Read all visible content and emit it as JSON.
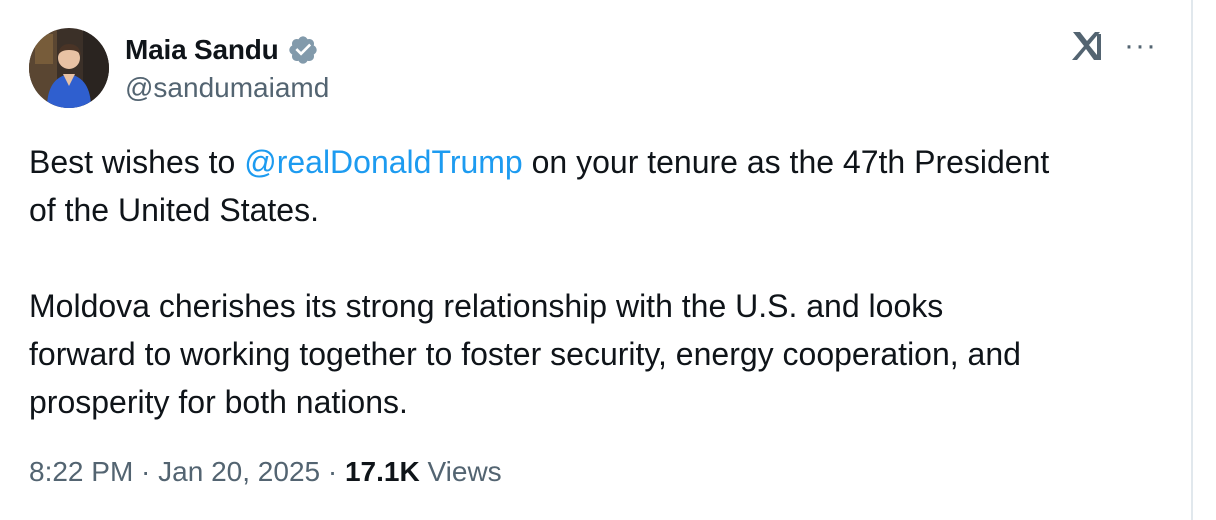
{
  "author": {
    "display_name": "Maia Sandu",
    "handle": "@sandumaiamd",
    "verified": true,
    "verified_badge_color": "#829aab"
  },
  "icons": {
    "x_logo": "x-logo-icon",
    "more": "more-options-icon",
    "more_glyph": "···"
  },
  "tweet": {
    "line1_prefix": "Best wishes to ",
    "mention": "@realDonaldTrump",
    "line1_suffix": " on your tenure as the 47th President",
    "line2": "of the United States.",
    "para2_line1": "Moldova cherishes its strong relationship with the U.S. and looks",
    "para2_line2": "forward to working together to foster security, energy cooperation, and",
    "para2_line3": "prosperity for both nations."
  },
  "meta": {
    "time": "8:22 PM",
    "sep1": " · ",
    "date": "Jan 20, 2025",
    "sep2": " · ",
    "views_count": "17.1K",
    "views_label": " Views"
  },
  "colors": {
    "text": "#0f1419",
    "secondary": "#536471",
    "link": "#1d9bf0"
  }
}
